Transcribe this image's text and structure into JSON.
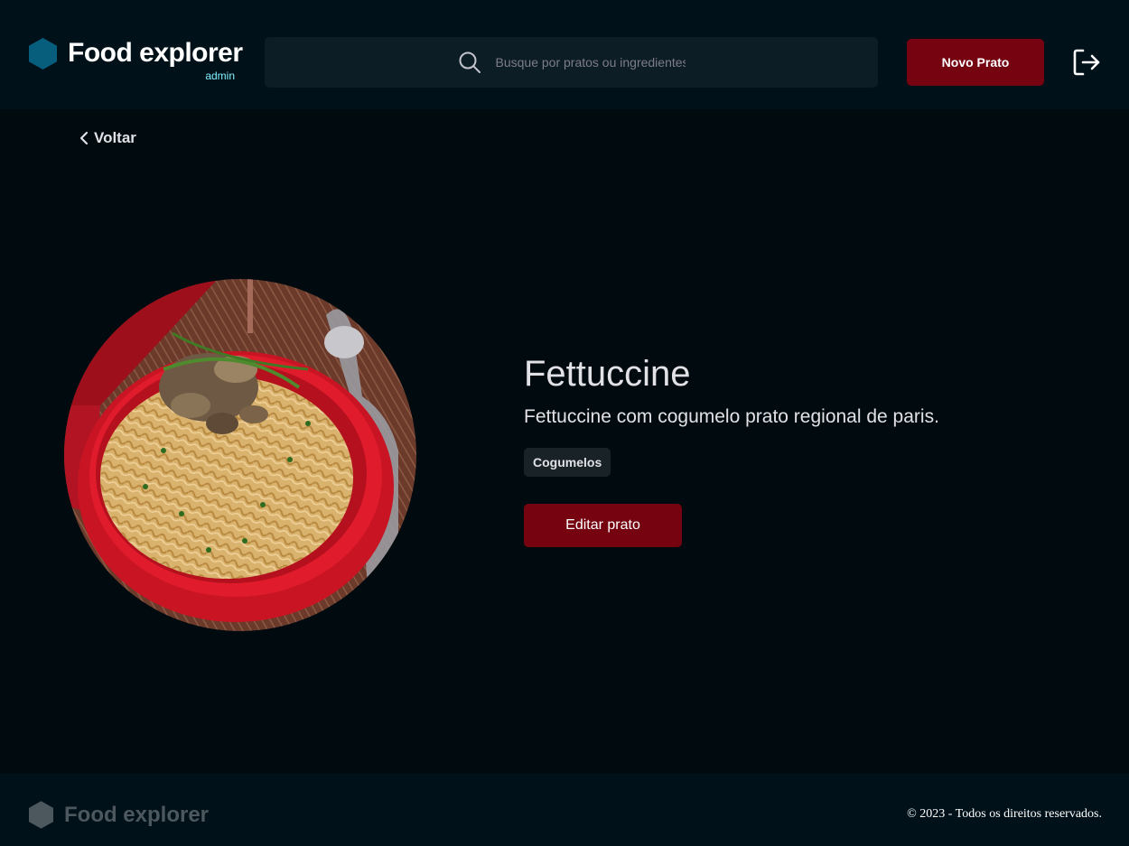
{
  "header": {
    "brand_name": "Food explorer",
    "brand_role": "admin",
    "search_placeholder": "Busque por pratos ou ingredientes",
    "new_dish_label": "Novo Prato",
    "icons": {
      "logo": "hexagon-logo-icon",
      "search": "search-icon",
      "logout": "sign-out-icon"
    }
  },
  "nav": {
    "back_label": "Voltar",
    "back_icon": "chevron-left-icon"
  },
  "dish": {
    "title": "Fettuccine",
    "description": "Fettuccine com cogumelo prato regional de paris.",
    "ingredients": [
      "Cogumelos"
    ],
    "edit_label": "Editar prato"
  },
  "footer": {
    "brand_name": "Food explorer",
    "copyright": "© 2023 - Todos os direitos reservados."
  },
  "colors": {
    "background": "#000A0F",
    "header_bg": "#00111A",
    "accent_button": "#750310",
    "admin_label": "#82F3FF",
    "logo_hex": "#065E7C"
  }
}
